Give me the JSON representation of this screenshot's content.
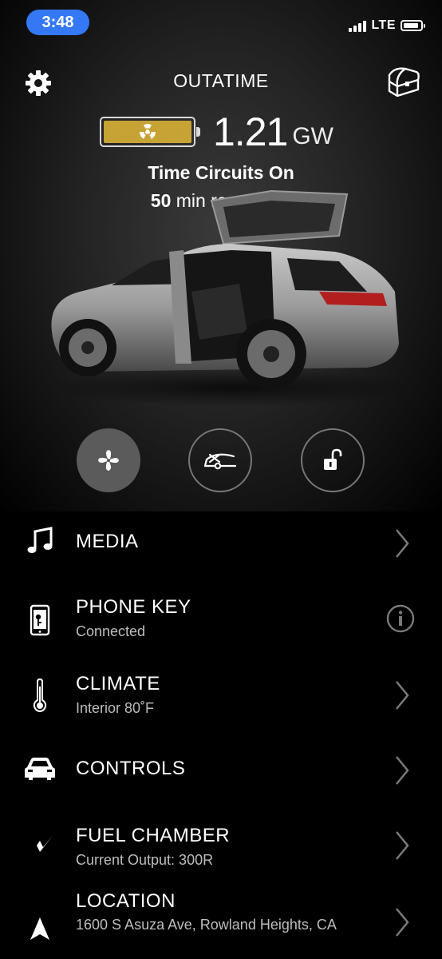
{
  "status_bar": {
    "time": "3:48",
    "network": "LTE",
    "battery_level": 0.75
  },
  "header": {
    "title": "OUTATIME",
    "left_icon": "gear-icon",
    "right_icon": "treasure-chest-icon"
  },
  "range": {
    "value": "1.21",
    "unit": "GW",
    "battery_fill": 1.0,
    "battery_color": "#c7a335",
    "battery_icon": "radiation-icon"
  },
  "status": {
    "line1": "Time Circuits On",
    "line2_number": "50",
    "line2_text": " min remaining"
  },
  "quick_actions": [
    {
      "name": "fan",
      "icon": "fan-icon"
    },
    {
      "name": "frunk",
      "icon": "frunk-icon"
    },
    {
      "name": "lock",
      "icon": "unlock-icon"
    }
  ],
  "menu": {
    "media": {
      "label": "MEDIA",
      "icon": "music-note-icon"
    },
    "phone_key": {
      "label": "PHONE KEY",
      "sub": "Connected",
      "icon": "phone-key-icon"
    },
    "climate": {
      "label": "CLIMATE",
      "sub": "Interior 80˚F",
      "icon": "thermometer-icon"
    },
    "controls": {
      "label": "CONTROLS",
      "icon": "car-front-icon"
    },
    "fuel": {
      "label": "FUEL CHAMBER",
      "sub": "Current Output: 300R",
      "icon": "lightning-icon"
    },
    "location": {
      "label": "LOCATION",
      "sub": "1600 S Asuza Ave, Rowland Heights, CA",
      "icon": "navigation-arrow-icon"
    }
  },
  "colors": {
    "accent_blue": "#3478f6",
    "battery_gold": "#c7a335"
  }
}
